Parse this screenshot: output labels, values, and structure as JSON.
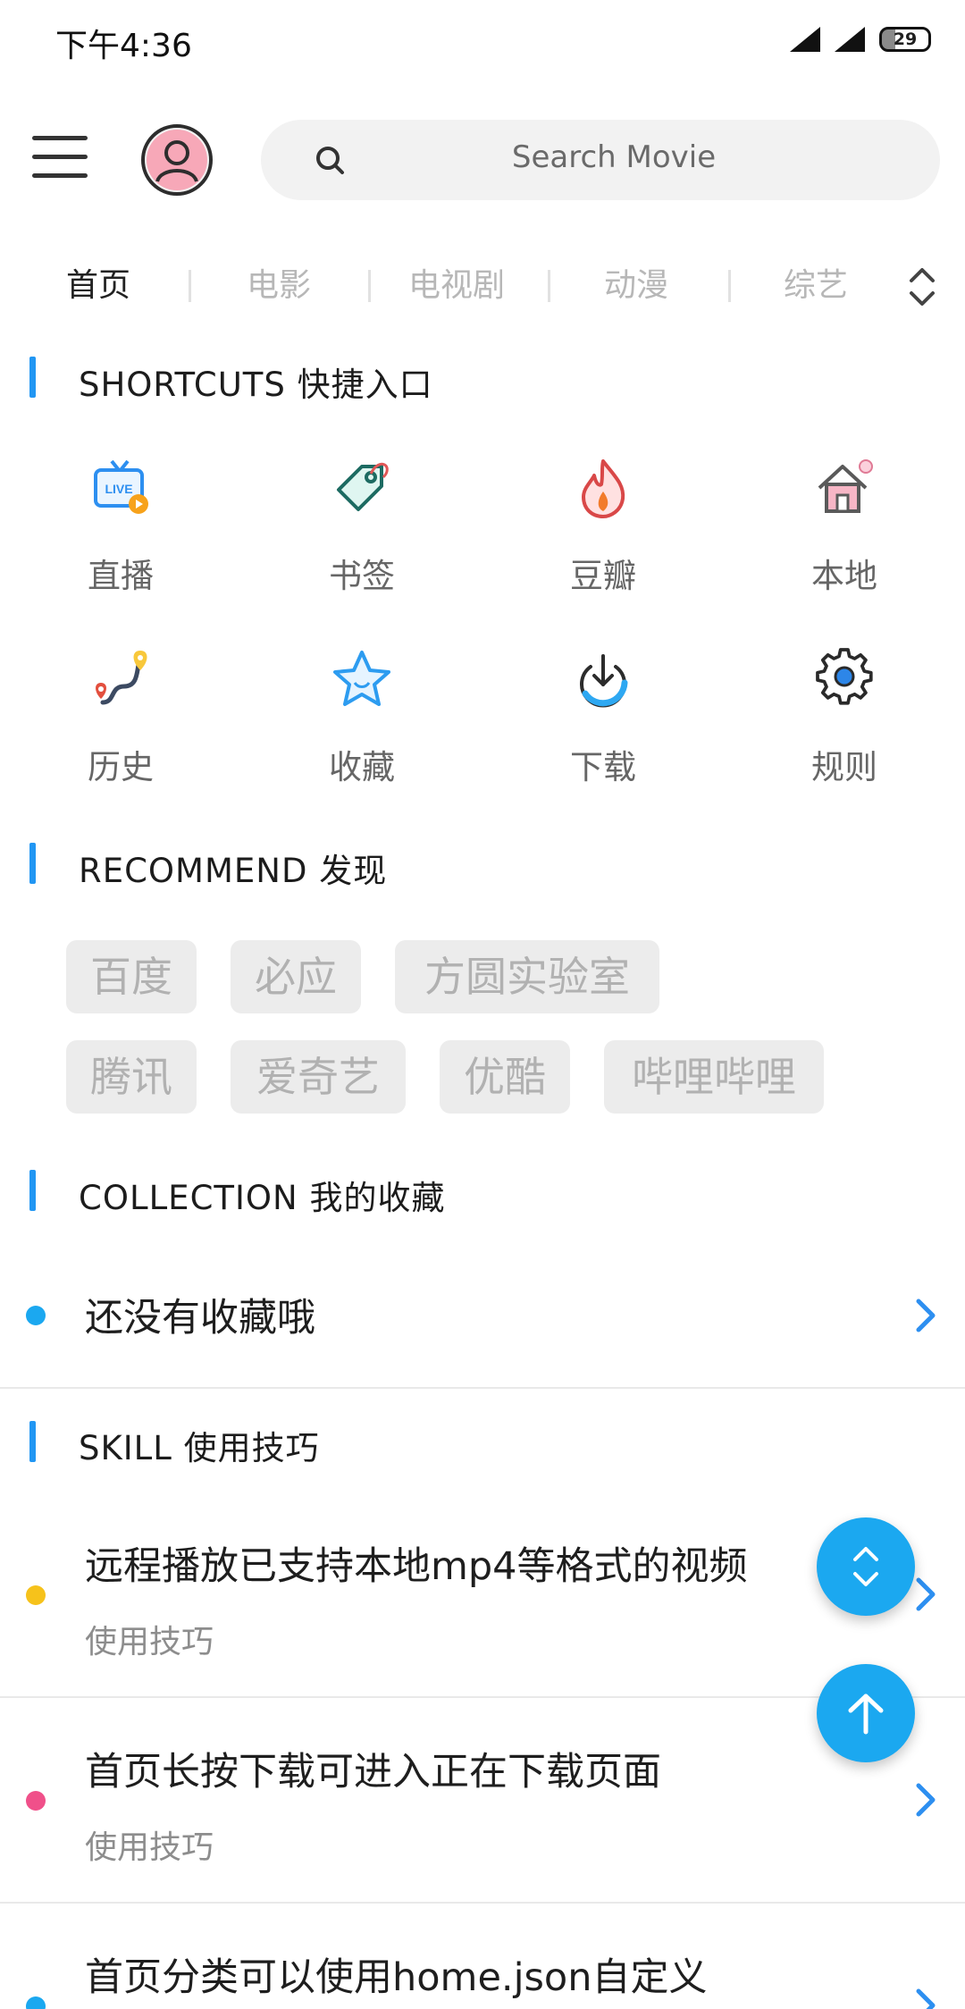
{
  "status": {
    "time": "下午4:36",
    "battery": "29"
  },
  "search": {
    "placeholder": "Search Movie"
  },
  "tabs": [
    "首页",
    "电影",
    "电视剧",
    "动漫",
    "综艺"
  ],
  "sections": {
    "shortcuts": "SHORTCUTS  快捷入口",
    "recommend": "RECOMMEND  发现",
    "collection": "COLLECTION  我的收藏",
    "skill": "SKILL  使用技巧"
  },
  "shortcuts": [
    {
      "label": "直播",
      "icon": "live-tv-icon"
    },
    {
      "label": "书签",
      "icon": "bookmark-tag-icon"
    },
    {
      "label": "豆瓣",
      "icon": "flame-icon"
    },
    {
      "label": "本地",
      "icon": "home-icon"
    },
    {
      "label": "历史",
      "icon": "route-pin-icon"
    },
    {
      "label": "收藏",
      "icon": "star-icon"
    },
    {
      "label": "下载",
      "icon": "download-icon"
    },
    {
      "label": "规则",
      "icon": "gear-icon"
    }
  ],
  "recommend": [
    "百度",
    "必应",
    "方圆实验室",
    "腾讯",
    "爱奇艺",
    "优酷",
    "哔哩哔哩"
  ],
  "collection": {
    "empty": "还没有收藏哦",
    "dot_color": "#1ba8f0"
  },
  "tips": [
    {
      "title": "远程播放已支持本地mp4等格式的视频",
      "sub": "使用技巧",
      "dot_color": "#f6c21b"
    },
    {
      "title": "首页长按下载可进入正在下载页面",
      "sub": "使用技巧",
      "dot_color": "#f0508a"
    },
    {
      "title": "首页分类可以使用home.json自定义",
      "sub": "",
      "dot_color": "#1ba8f0"
    }
  ],
  "colors": {
    "accent": "#1ba8f0",
    "section_bar": "#2196f3"
  }
}
